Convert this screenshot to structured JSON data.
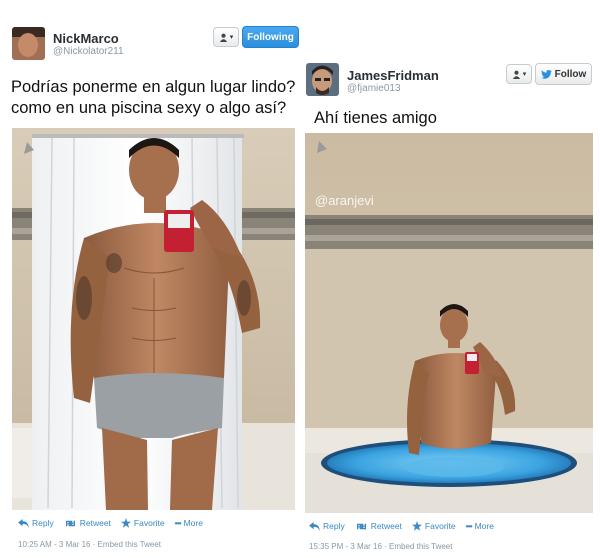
{
  "left": {
    "name": "NickMarco",
    "handle": "@Nickolator211",
    "follow_label": "Following",
    "text_line1": "Podrías ponerme en algun lugar lindo?",
    "text_line2": "como en una piscina sexy o algo así?",
    "actions": {
      "reply": "Reply",
      "retweet": "Retweet",
      "favorite": "Favorite",
      "more": "More"
    },
    "timestamp": "10:25 AM - 3 Mar 16 · Embed this Tweet"
  },
  "right": {
    "name": "JamesFridman",
    "handle": "@fjamie013",
    "follow_label": "Follow",
    "text": "Ahí tienes amigo",
    "watermark": "@aranjevi",
    "actions": {
      "reply": "Reply",
      "retweet": "Retweet",
      "favorite": "Favorite",
      "more": "More"
    },
    "timestamp": "15:35 PM - 3 Mar 16 · Embed this Tweet"
  },
  "colors": {
    "link_blue": "#3b88c3",
    "button_blue": "#2b8fdd",
    "pool_blue": "#3aa3e0"
  },
  "icons": [
    "user-menu-icon",
    "bird-icon",
    "reply-icon",
    "retweet-icon",
    "star-icon",
    "more-dots-icon"
  ]
}
